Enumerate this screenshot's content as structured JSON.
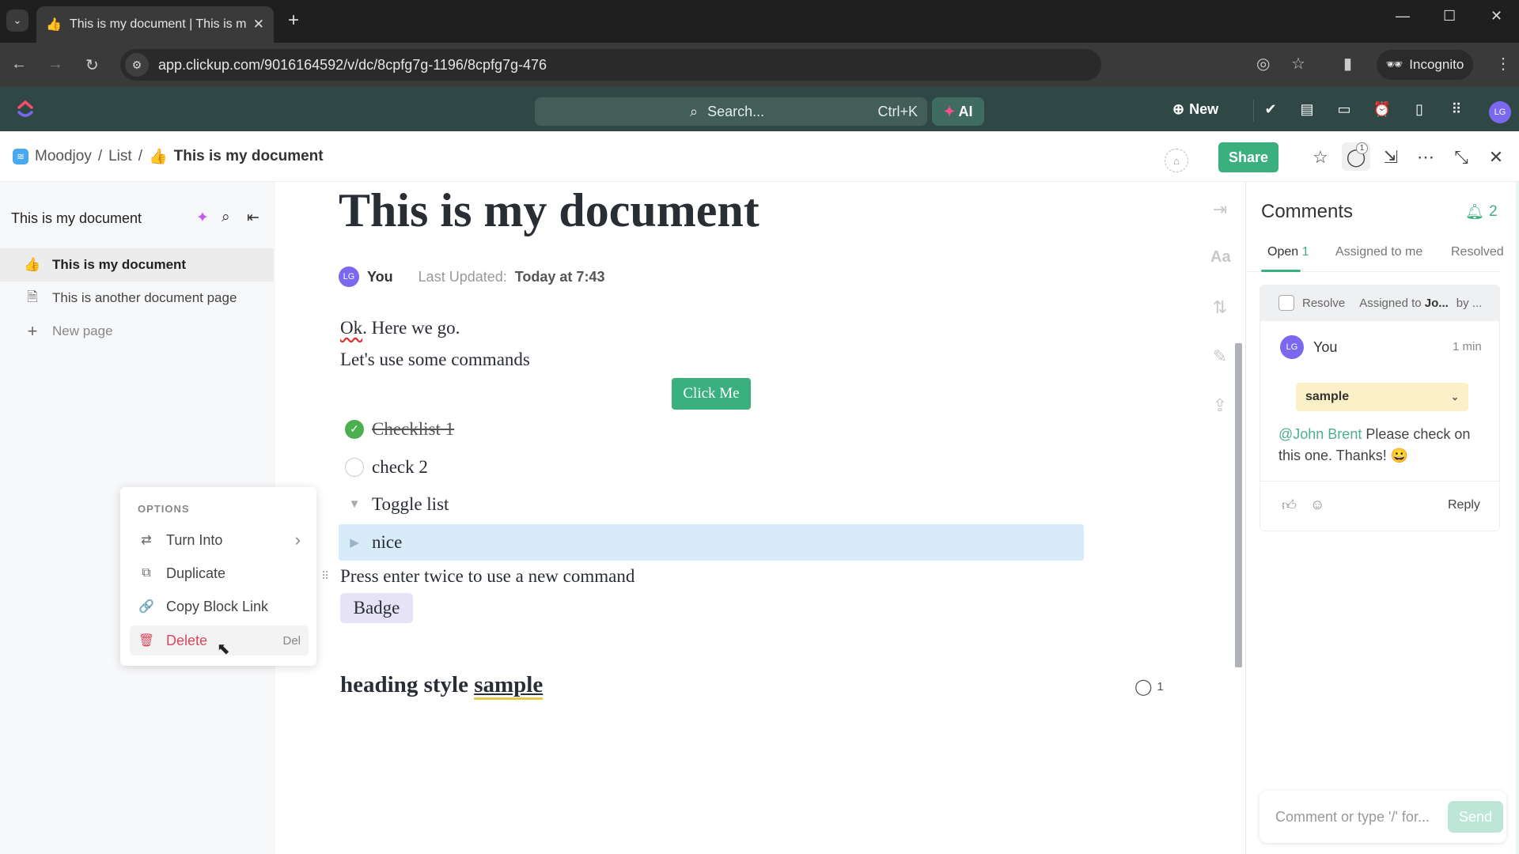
{
  "browser": {
    "tab_title": "This is my document | This is m",
    "tab_favicon": "thumbs-up-emoji",
    "url": "app.clickup.com/9016164592/v/dc/8cpfg7g-1196/8cpfg7g-476",
    "incognito_label": "Incognito"
  },
  "app_header": {
    "search_placeholder": "Search...",
    "search_shortcut": "Ctrl+K",
    "ai_label": "AI",
    "new_label": "New",
    "avatar_initials": "LG",
    "icons": [
      "check-circle-icon",
      "notepad-icon",
      "video-icon",
      "alarm-icon",
      "doc-icon",
      "apps-grid-icon"
    ]
  },
  "breadcrumb": {
    "space": "Moodjoy",
    "list": "List",
    "current_emoji": "👍",
    "current": "This is my document",
    "separator": "/"
  },
  "toolbar": {
    "share_label": "Share",
    "comment_badge": "1"
  },
  "sidebar": {
    "title": "This is my document",
    "items": [
      {
        "icon": "👍",
        "label": "This is my document",
        "active": true
      },
      {
        "icon": "🗎",
        "label": "This is another document page",
        "active": false
      },
      {
        "icon": "+",
        "label": "New page",
        "active": false
      }
    ]
  },
  "context_menu": {
    "header": "OPTIONS",
    "items": [
      {
        "label": "Turn Into",
        "icon": "⇄",
        "trail": "›"
      },
      {
        "label": "Duplicate",
        "icon": "⧉",
        "trail": ""
      },
      {
        "label": "Copy Block Link",
        "icon": "🔗",
        "trail": ""
      },
      {
        "label": "Delete",
        "icon": "🗑",
        "trail": "Del"
      }
    ]
  },
  "document": {
    "title": "This is my document",
    "author_initials": "LG",
    "author": "You",
    "last_updated_label": "Last Updated:",
    "last_updated_value": "Today at 7:43",
    "para1_ok": "Ok",
    "para1_rest": ". Here we go.",
    "para2": "Let's use some commands",
    "button_label": "Click Me",
    "checklist": [
      {
        "label": "Checklist 1",
        "done": true
      },
      {
        "label": "check 2",
        "done": false
      }
    ],
    "toggle_label": "Toggle list",
    "nested_toggle_label": "nice",
    "hint": "Press enter twice to use a new command",
    "badge": "Badge",
    "heading_prefix": "heading style ",
    "heading_highlight": "sample",
    "heading_comment_count": "1"
  },
  "comments_panel": {
    "title": "Comments",
    "notification_count": "2",
    "tabs": [
      {
        "label": "Open",
        "count": "1",
        "active": true
      },
      {
        "label": "Assigned to me",
        "active": false
      },
      {
        "label": "Resolved",
        "active": false
      }
    ],
    "card": {
      "resolve_label": "Resolve",
      "assigned_prefix": "Assigned to ",
      "assigned_name": "Jo...",
      "by": "by ...",
      "author_initials": "LG",
      "author": "You",
      "time": "1 min",
      "quote": "sample",
      "mention": "@John Brent",
      "text": " Please check on this one. Thanks! 😀",
      "reply_label": "Reply"
    },
    "input_placeholder": "Comment or type '/' for...",
    "send_label": "Send"
  },
  "colors": {
    "brand_green": "#3bb07f",
    "header_bg": "#2f4845",
    "avatar_purple": "#7b68ee",
    "danger": "#d9485f",
    "highlight_yellow": "#e7c94a"
  }
}
